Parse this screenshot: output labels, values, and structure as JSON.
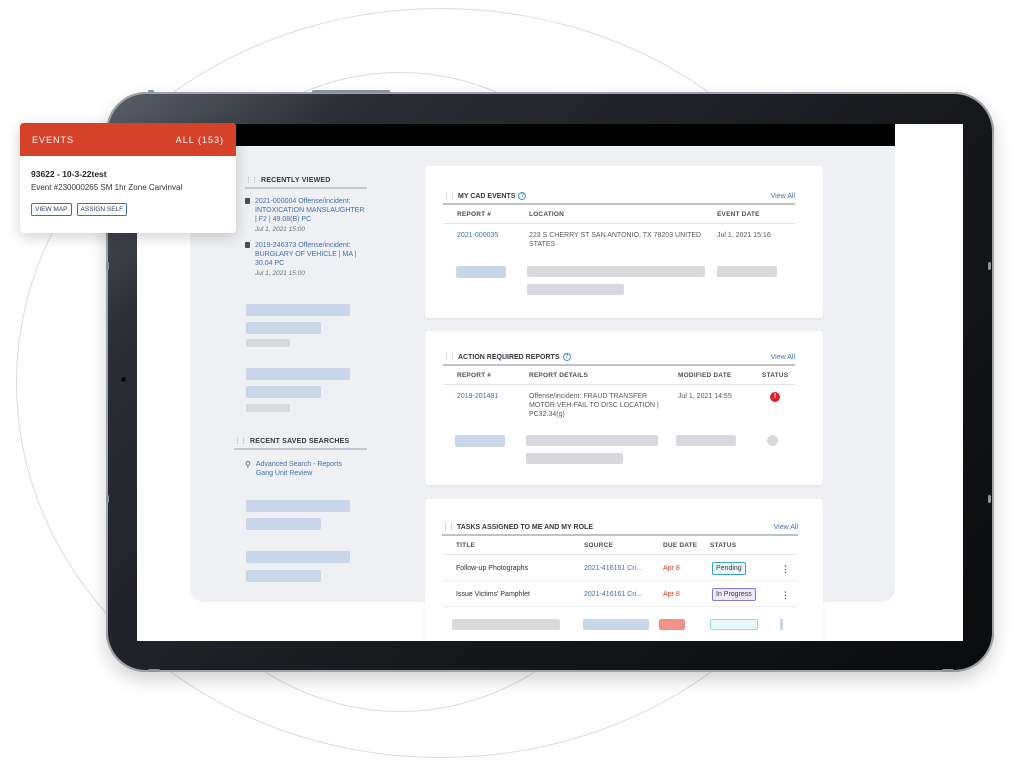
{
  "events_popup": {
    "title": "EVENTS",
    "all_label": "ALL (153)",
    "event_name": "93622 - 10-3-22test",
    "event_detail": "Event #230000265 SM 1hr Zone Carvinval",
    "view_map": "VIEW MAP",
    "assign_self": "ASSIGN SELF"
  },
  "recently_viewed": {
    "title": "RECENTLY VIEWED",
    "items": [
      {
        "label": "2021-000004 Offense/incident: INTOXICATION MANSLAUGHTER | F2 | 49.08(B) PC",
        "date": "Jul 1, 2021 15:00"
      },
      {
        "label": "2019-246373 Offense/incident: BURGLARY OF VEHICLE | MA | 30.04 PC",
        "date": "Jul 1, 2021 15:00"
      }
    ]
  },
  "recent_searches": {
    "title": "RECENT SAVED SEARCHES",
    "items": [
      {
        "label": "Advanced Search - Reports Gang Unit Review"
      }
    ]
  },
  "cad_events": {
    "title": "MY CAD EVENTS",
    "view_all": "View All",
    "columns": [
      "REPORT #",
      "LOCATION",
      "EVENT DATE"
    ],
    "rows": [
      {
        "report": "2021-000035",
        "location": "223 S CHERRY ST SAN ANTONIO, TX 78203 UNITED STATES",
        "date": "Jul 1, 2021 15:16"
      }
    ]
  },
  "action_reports": {
    "title": "ACTION REQUIRED REPORTS",
    "view_all": "View All",
    "columns": [
      "REPORT #",
      "REPORT DETAILS",
      "MODIFIED DATE",
      "STATUS"
    ],
    "rows": [
      {
        "report": "2019-201481",
        "details": "Offense/incident: FRAUD TRANSFER MOTOR VEH-FAIL TO DISC LOCATION | PC32.34(g)",
        "modified": "Jul 1, 2021 14:55",
        "status_icon": "!"
      }
    ]
  },
  "tasks": {
    "title": "TASKS ASSIGNED TO ME AND MY ROLE",
    "view_all": "View All",
    "columns": [
      "TITLE",
      "SOURCE",
      "DUE DATE",
      "STATUS"
    ],
    "rows": [
      {
        "title": "Follow-up Photographs",
        "source": "2021-416161 Cri...",
        "due": "Apr 8",
        "status": "Pending"
      },
      {
        "title": "Issue Victims' Pamphlet",
        "source": "2021-416161 Cri...",
        "due": "Apr 8",
        "status": "In Progress"
      }
    ]
  },
  "colors": {
    "accent_red": "#d6412a",
    "link_blue": "#3f6fb0",
    "alert_red": "#d8232a"
  }
}
